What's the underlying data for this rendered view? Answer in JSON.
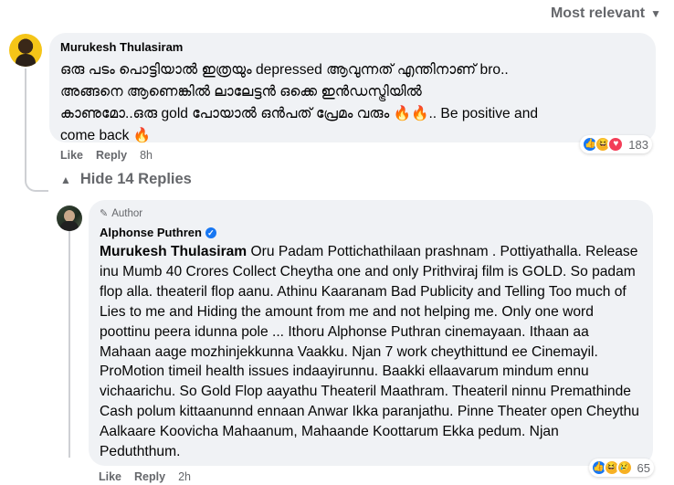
{
  "sort": {
    "label": "Most relevant",
    "icon": "chevron-down-icon"
  },
  "comment": {
    "author": "Murukesh Thulasiram",
    "text": "ഒരു പടം പൊട്ടിയാൽ ഇത്രയും depressed ആവുന്നത് എന്തിനാണ് bro..\nഅങ്ങനെ ആണെങ്കിൽ ലാലേട്ടൻ ഒക്കെ ഇൻഡസ്ട്രിയിൽ\nകാണുമോ..ഒരു gold പോയാൽ ഒൻപത് പ്രേമം വരും",
    "text_tail_1": "🔥🔥",
    "text_tail_2": ".. Be positive and\ncome back ",
    "text_tail_3": "🔥",
    "like_label": "Like",
    "reply_label": "Reply",
    "time": "8h",
    "reaction_count": "183",
    "reactions": [
      "like",
      "haha",
      "love"
    ]
  },
  "replies_toggle": {
    "label": "Hide 14 Replies",
    "icon": "chevron-up-icon"
  },
  "reply": {
    "badge": "Author",
    "author": "Alphonse Puthren",
    "verified": true,
    "mention": "Murukesh Thulasiram",
    "text": " Oru Padam Potticha­thilaan prashnam . Pottiyathalla. Release inu Mumb 40 Crores Collect Cheytha one and only Prithviraj film is GOLD. So padam flop alla. theateril flop aanu. Athinu Kaaranam Bad Publicity and Telling Too much of Lies to me and Hiding the amount from me and not helping me. Only one word poottinu peera idunna pole ... Ithoru Alphonse Puthran cinemayaan. Ithaan aa Mahaan aage mozhinjekkunna Vaakku. Njan 7 work cheythittund ee Cinemayil. ProMotion timeil health issues indaayirunnu. Baakki ellaavarum mindum ennu vichaarichu. So Gold Flop aayathu Theateril Maathram. Theateril ninnu Premathinde Cash polum kittaanunnd ennaan Anwar Ikka paranjathu. Pinne Theater open Cheythu Aalkaare Koovicha Mahaanum, Mahaande Koottarum Ekka pedum. Njan Peduththum.",
    "like_label": "Like",
    "reply_label": "Reply",
    "time": "2h",
    "reaction_count": "65",
    "reactions": [
      "like",
      "haha",
      "sad"
    ]
  }
}
